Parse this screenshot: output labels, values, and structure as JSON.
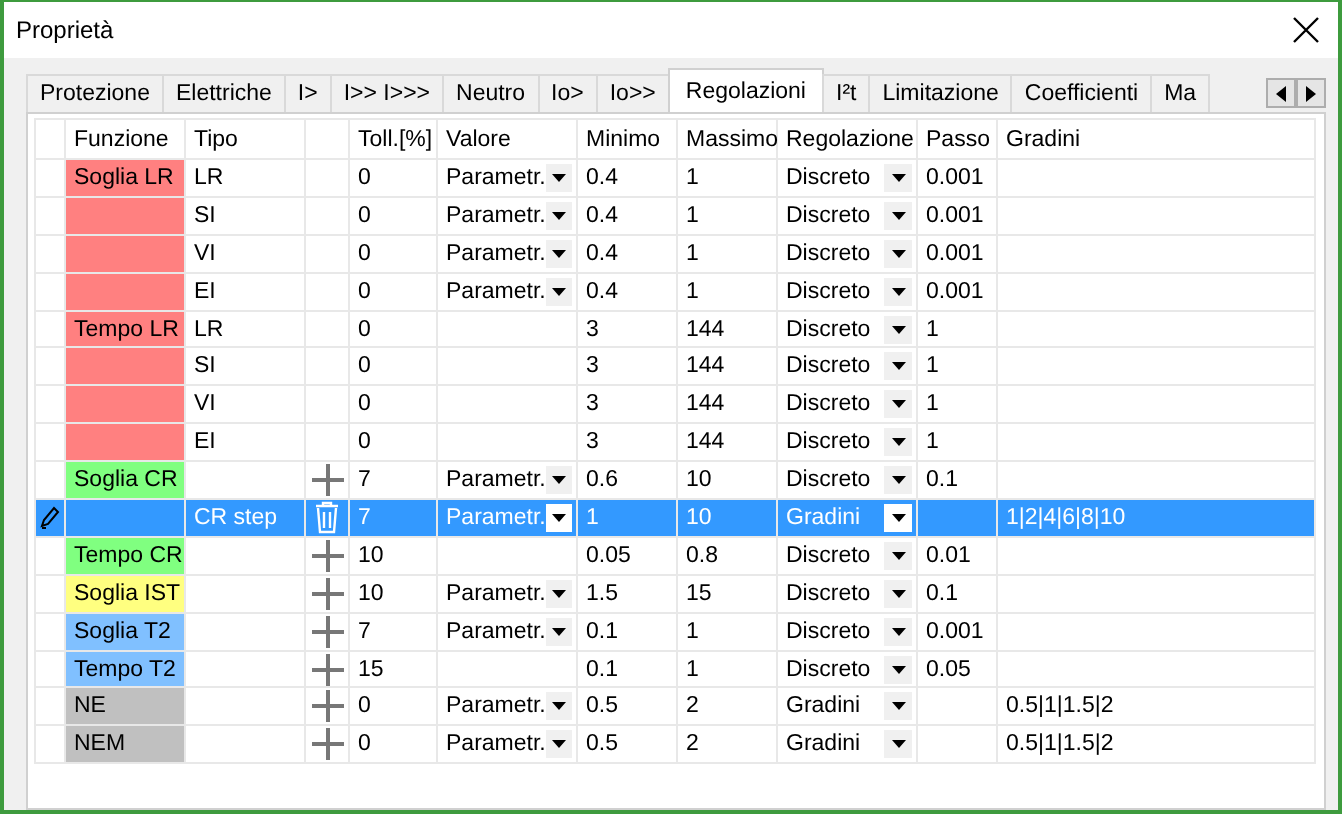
{
  "window": {
    "title": "Proprietà"
  },
  "tabs": [
    {
      "label": "Protezione",
      "selected": false
    },
    {
      "label": "Elettriche",
      "selected": false
    },
    {
      "label": "I>",
      "selected": false
    },
    {
      "label": "I>> I>>>",
      "selected": false
    },
    {
      "label": "Neutro",
      "selected": false
    },
    {
      "label": "Io>",
      "selected": false
    },
    {
      "label": "Io>>",
      "selected": false
    },
    {
      "label": "Regolazioni",
      "selected": true
    },
    {
      "label": "I²t",
      "selected": false
    },
    {
      "label": "Limitazione",
      "selected": false
    },
    {
      "label": "Coefficienti",
      "selected": false
    },
    {
      "label": "Ma",
      "selected": false
    }
  ],
  "table": {
    "columns": [
      "Funzione",
      "Tipo",
      "Toll.[%]",
      "Valore",
      "Minimo",
      "Massimo",
      "Regolazione",
      "Passo",
      "Gradini"
    ],
    "rows": [
      {
        "funzione": "Soglia LR",
        "color": "#ff8080",
        "tipo": "LR",
        "toll": "0",
        "valore": "Parametr.",
        "minimo": "0.4",
        "massimo": "1",
        "regolazione": "Discreto",
        "passo": "0.001",
        "selected": false
      },
      {
        "color": "#ff8080",
        "tipo": "SI",
        "toll": "0",
        "valore": "Parametr.",
        "minimo": "0.4",
        "massimo": "1",
        "regolazione": "Discreto",
        "passo": "0.001",
        "selected": false
      },
      {
        "color": "#ff8080",
        "tipo": "VI",
        "toll": "0",
        "valore": "Parametr.",
        "minimo": "0.4",
        "massimo": "1",
        "regolazione": "Discreto",
        "passo": "0.001",
        "selected": false
      },
      {
        "color": "#ff8080",
        "tipo": "EI",
        "toll": "0",
        "valore": "Parametr.",
        "minimo": "0.4",
        "massimo": "1",
        "regolazione": "Discreto",
        "passo": "0.001",
        "selected": false
      },
      {
        "funzione": "Tempo LR",
        "color": "#ff8080",
        "tipo": "LR",
        "toll": "0",
        "minimo": "3",
        "massimo": "144",
        "regolazione": "Discreto",
        "passo": "1",
        "selected": false
      },
      {
        "color": "#ff8080",
        "tipo": "SI",
        "toll": "0",
        "minimo": "3",
        "massimo": "144",
        "regolazione": "Discreto",
        "passo": "1",
        "selected": false
      },
      {
        "color": "#ff8080",
        "tipo": "VI",
        "toll": "0",
        "minimo": "3",
        "massimo": "144",
        "regolazione": "Discreto",
        "passo": "1",
        "selected": false
      },
      {
        "color": "#ff8080",
        "tipo": "EI",
        "toll": "0",
        "minimo": "3",
        "massimo": "144",
        "regolazione": "Discreto",
        "passo": "1",
        "selected": false
      },
      {
        "funzione": "Soglia CR",
        "color": "#80ff80",
        "kind": "add",
        "toll": "7",
        "valore": "Parametr.",
        "minimo": "0.6",
        "massimo": "10",
        "regolazione": "Discreto",
        "passo": "0.1",
        "selected": false
      },
      {
        "tipo": "CR step",
        "kind": "delete",
        "toll": "7",
        "valore": "Parametr.",
        "minimo": "1",
        "massimo": "10",
        "regolazione": "Gradini",
        "gradini": "1|2|4|6|8|10",
        "selected": true
      },
      {
        "funzione": "Tempo CR",
        "color": "#80ff80",
        "kind": "add",
        "toll": "10",
        "minimo": "0.05",
        "massimo": "0.8",
        "regolazione": "Discreto",
        "passo": "0.01",
        "selected": false
      },
      {
        "funzione": "Soglia IST",
        "color": "#ffff80",
        "kind": "add",
        "toll": "10",
        "valore": "Parametr.",
        "minimo": "1.5",
        "massimo": "15",
        "regolazione": "Discreto",
        "passo": "0.1",
        "selected": false
      },
      {
        "funzione": "Soglia T2",
        "color": "#80c0ff",
        "kind": "add",
        "toll": "7",
        "valore": "Parametr.",
        "minimo": "0.1",
        "massimo": "1",
        "regolazione": "Discreto",
        "passo": "0.001",
        "selected": false
      },
      {
        "funzione": "Tempo T2",
        "color": "#80c0ff",
        "kind": "add",
        "toll": "15",
        "minimo": "0.1",
        "massimo": "1",
        "regolazione": "Discreto",
        "passo": "0.05",
        "selected": false
      },
      {
        "funzione": "NE",
        "color": "#c0c0c0",
        "kind": "add",
        "toll": "0",
        "valore": "Parametr.",
        "minimo": "0.5",
        "massimo": "2",
        "regolazione": "Gradini",
        "gradini": "0.5|1|1.5|2",
        "selected": false
      },
      {
        "funzione": "NEM",
        "color": "#c0c0c0",
        "kind": "add",
        "toll": "0",
        "valore": "Parametr.",
        "minimo": "0.5",
        "massimo": "2",
        "regolazione": "Gradini",
        "gradini": "0.5|1|1.5|2",
        "selected": false
      }
    ]
  }
}
